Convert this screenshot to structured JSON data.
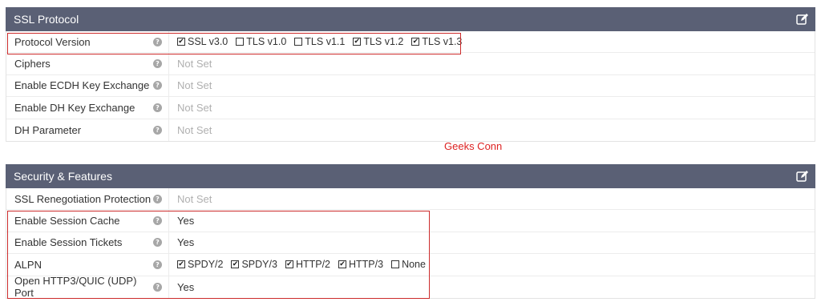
{
  "ssl": {
    "title": "SSL Protocol",
    "rows": {
      "protocol_version": {
        "label": "Protocol Version",
        "options": [
          {
            "label": "SSL v3.0",
            "checked": true
          },
          {
            "label": "TLS v1.0",
            "checked": false
          },
          {
            "label": "TLS v1.1",
            "checked": false
          },
          {
            "label": "TLS v1.2",
            "checked": true
          },
          {
            "label": "TLS v1.3",
            "checked": true
          }
        ]
      },
      "ciphers": {
        "label": "Ciphers",
        "value": "Not Set"
      },
      "ecdh": {
        "label": "Enable ECDH Key Exchange",
        "value": "Not Set"
      },
      "dh": {
        "label": "Enable DH Key Exchange",
        "value": "Not Set"
      },
      "dh_param": {
        "label": "DH Parameter",
        "value": "Not Set"
      }
    }
  },
  "watermark": "Geeks Conn",
  "security": {
    "title": "Security & Features",
    "rows": {
      "renegotiation": {
        "label": "SSL Renegotiation Protection",
        "value": "Not Set"
      },
      "session_cache": {
        "label": "Enable Session Cache",
        "value": "Yes"
      },
      "session_tickets": {
        "label": "Enable Session Tickets",
        "value": "Yes"
      },
      "alpn": {
        "label": "ALPN",
        "options": [
          {
            "label": "SPDY/2",
            "checked": true
          },
          {
            "label": "SPDY/3",
            "checked": true
          },
          {
            "label": "HTTP/2",
            "checked": true
          },
          {
            "label": "HTTP/3",
            "checked": true
          },
          {
            "label": "None",
            "checked": false
          }
        ]
      },
      "http3_port": {
        "label": "Open HTTP3/QUIC (UDP) Port",
        "value": "Yes"
      }
    }
  },
  "icons": {
    "edit": "edit-icon",
    "help": "help-icon",
    "checkbox_checked": "checkbox-checked-icon",
    "checkbox_empty": "checkbox-empty-icon"
  },
  "colors": {
    "header_bg": "#5a6075",
    "highlight": "#cc2b2b",
    "not_set": "#b0b0b0",
    "watermark": "#dd2222"
  }
}
